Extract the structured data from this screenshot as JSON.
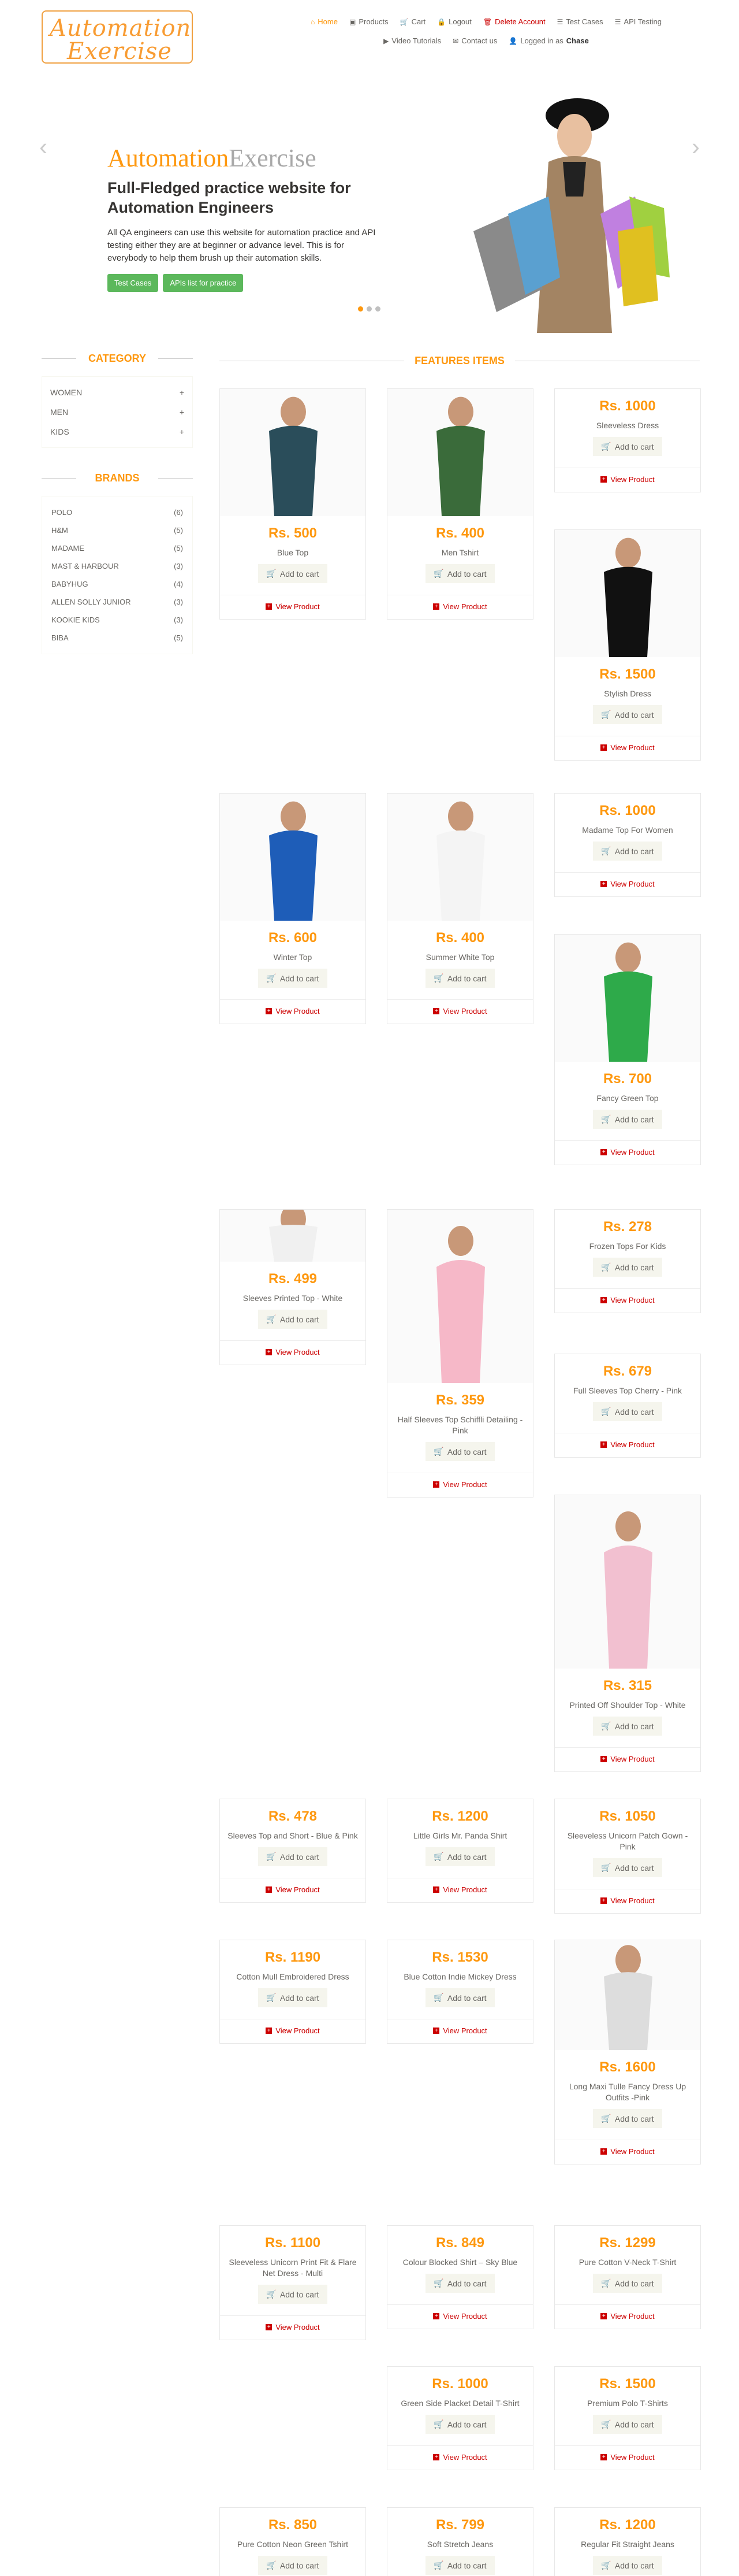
{
  "logo": {
    "line1": "Automation",
    "line2": "Exercise"
  },
  "nav": {
    "row1": [
      {
        "icon": "home-icon",
        "glyph": "⌂",
        "label": "Home",
        "active": true
      },
      {
        "icon": "shop-icon",
        "glyph": "▣",
        "label": "Products"
      },
      {
        "icon": "cart-icon",
        "glyph": "🛒",
        "label": "Cart"
      },
      {
        "icon": "lock-icon",
        "glyph": "🔒",
        "label": "Logout"
      },
      {
        "icon": "trash-icon",
        "glyph": "🗑",
        "label": "Delete Account",
        "red": true
      },
      {
        "icon": "list-icon",
        "glyph": "☰",
        "label": "Test Cases"
      },
      {
        "icon": "list-icon",
        "glyph": "☰",
        "label": "API Testing"
      }
    ],
    "row2": [
      {
        "icon": "youtube-icon",
        "glyph": "▶",
        "label": "Video Tutorials"
      },
      {
        "icon": "envelope-icon",
        "glyph": "✉",
        "label": "Contact us"
      },
      {
        "icon": "user-icon",
        "glyph": "👤",
        "label": "Logged in as",
        "user": "Chase"
      }
    ]
  },
  "slider": {
    "title_a": "Automation",
    "title_b": "Exercise",
    "subtitle": "Full-Fledged practice website for Automation Engineers",
    "description": "All QA engineers can use this website for automation practice and API testing either they are at beginner or advance level. This is for everybody to help them brush up their automation skills.",
    "btn_test_cases": "Test Cases",
    "btn_apis": "APIs list for practice"
  },
  "sidebar": {
    "category_title": "CATEGORY",
    "categories": [
      "Women",
      "Men",
      "Kids"
    ],
    "brands_title": "BRANDS",
    "brands": [
      {
        "name": "Polo",
        "count": "(6)"
      },
      {
        "name": "H&M",
        "count": "(5)"
      },
      {
        "name": "Madame",
        "count": "(5)"
      },
      {
        "name": "Mast & Harbour",
        "count": "(3)"
      },
      {
        "name": "Babyhug",
        "count": "(4)"
      },
      {
        "name": "Allen Solly Junior",
        "count": "(3)"
      },
      {
        "name": "Kookie Kids",
        "count": "(3)"
      },
      {
        "name": "Biba",
        "count": "(5)"
      }
    ]
  },
  "features": {
    "title": "FEATURES ITEMS",
    "add_label": "Add to cart",
    "view_label": "View Product",
    "products": [
      {
        "price": "Rs. 500",
        "name": "Blue Top",
        "img": "blue-top-image",
        "color": "#2a4d5a"
      },
      {
        "price": "Rs. 400",
        "name": "Men Tshirt",
        "img": "men-tshirt-image",
        "color": "#3a6b3a"
      },
      {
        "price": "Rs. 1000",
        "name": "Sleeveless Dress"
      },
      {
        "price": "Rs. 1500",
        "name": "Stylish Dress",
        "img": "stylish-dress-image",
        "color": "#111"
      },
      {
        "price": "Rs. 600",
        "name": "Winter Top",
        "img": "winter-top-image",
        "color": "#1e5db8"
      },
      {
        "price": "Rs. 400",
        "name": "Summer White Top",
        "img": "summer-white-top-image",
        "color": "#eee"
      },
      {
        "price": "Rs. 1000",
        "name": "Madame Top For Women"
      },
      {
        "price": "Rs. 700",
        "name": "Fancy Green Top",
        "img": "fancy-green-top-image",
        "color": "#2eaa4a"
      },
      {
        "price": "Rs. 278",
        "name": "Frozen Tops For Kids"
      },
      {
        "price": "Rs. 499",
        "name": "Sleeves Printed Top - White",
        "img": "sleeves-printed-top-image",
        "color": "#e8e8e8"
      },
      {
        "price": "Rs. 359",
        "name": "Half Sleeves Top Schiffli Detailing - Pink",
        "img": "half-sleeves-top-image",
        "color": "#f6b8c8"
      },
      {
        "price": "Rs. 679",
        "name": "Full Sleeves Top Cherry - Pink"
      },
      {
        "price": "Rs. 315",
        "name": "Printed Off Shoulder Top - White",
        "img": "off-shoulder-top-image",
        "color": "#f2c0d0"
      },
      {
        "price": "Rs. 478",
        "name": "Sleeves Top and Short - Blue & Pink"
      },
      {
        "price": "Rs. 1200",
        "name": "Little Girls Mr. Panda Shirt"
      },
      {
        "price": "Rs. 1050",
        "name": "Sleeveless Unicorn Patch Gown - Pink"
      },
      {
        "price": "Rs. 1190",
        "name": "Cotton Mull Embroidered Dress"
      },
      {
        "price": "Rs. 1530",
        "name": "Blue Cotton Indie Mickey Dress"
      },
      {
        "price": "Rs. 1600",
        "name": "Long Maxi Tulle Fancy Dress Up Outfits -Pink"
      },
      {
        "price": "Rs. 1100",
        "name": "Sleeveless Unicorn Print Fit & Flare Net Dress - Multi"
      },
      {
        "price": "Rs. 849",
        "name": "Colour Blocked Shirt – Sky Blue"
      },
      {
        "price": "Rs. 1299",
        "name": "Pure Cotton V-Neck T-Shirt"
      },
      {
        "price": "Rs. 1000",
        "name": "Green Side Placket Detail T-Shirt"
      },
      {
        "price": "Rs. 1500",
        "name": "Premium Polo T-Shirts"
      },
      {
        "price": "Rs. 850",
        "name": "Pure Cotton Neon Green Tshirt"
      },
      {
        "price": "Rs. 799",
        "name": "Soft Stretch Jeans"
      },
      {
        "price": "Rs. 1200",
        "name": "Regular Fit Straight Jeans"
      }
    ]
  }
}
